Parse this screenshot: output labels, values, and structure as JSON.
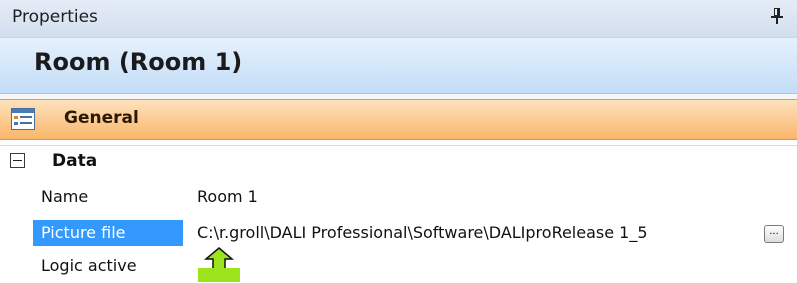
{
  "panel": {
    "title": "Properties"
  },
  "object": {
    "title": "Room (Room 1)"
  },
  "category": {
    "label": "General"
  },
  "group": {
    "label": "Data"
  },
  "properties": [
    {
      "name": "Name",
      "value": "Room 1"
    },
    {
      "name": "Picture file",
      "value": "C:\\r.groll\\DALI Professional\\Software\\DALIproRelease 1_5",
      "button": "..."
    },
    {
      "name": "Logic active",
      "value": ""
    }
  ],
  "icons": {
    "pin": "pin-icon",
    "category": "property-page-icon",
    "arrow": "up-arrow-icon"
  },
  "colors": {
    "selection": "#3399ff",
    "category_band": "#f9b66a",
    "header_band": "#c3ddf7",
    "annotation": "#9be31a"
  }
}
